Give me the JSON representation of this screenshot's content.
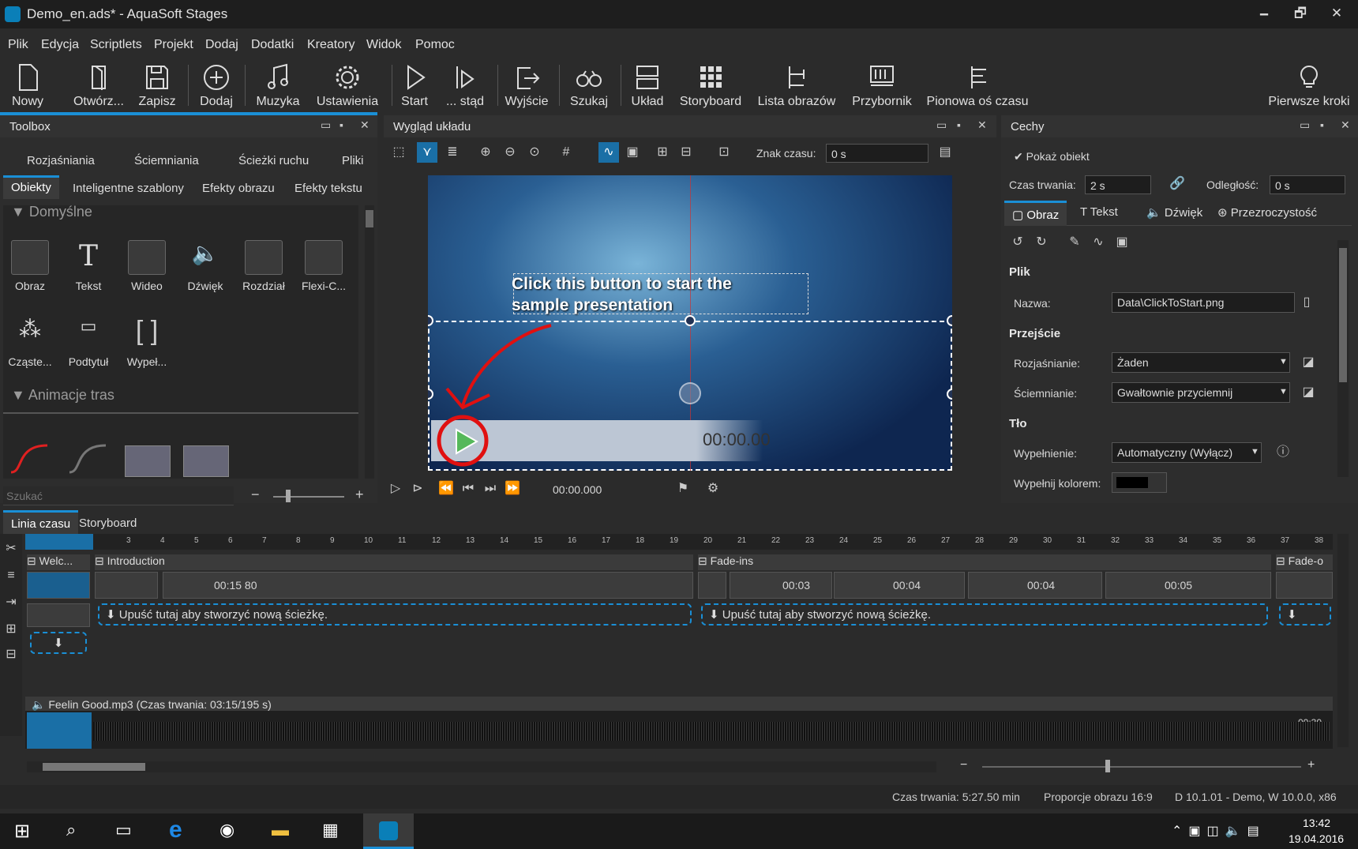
{
  "window": {
    "title": "Demo_en.ads* - AquaSoft Stages",
    "minimize": "🗕",
    "maximize": "🗗",
    "close": "✕"
  },
  "menu": [
    "Plik",
    "Edycja",
    "Scriptlets",
    "Projekt",
    "Dodaj",
    "Dodatki",
    "Kreatory",
    "Widok",
    "Pomoc"
  ],
  "toolbar": {
    "nowy": "Nowy",
    "otworz": "Otwórz...",
    "zapisz": "Zapisz",
    "dodaj": "Dodaj",
    "muzyka": "Muzyka",
    "ustawienia": "Ustawienia",
    "start": "Start",
    "stad": "... stąd",
    "wyjscie": "Wyjście",
    "szukaj": "Szukaj",
    "uklad": "Układ",
    "storyboard": "Storyboard",
    "lista": "Lista obrazów",
    "przybornik": "Przybornik",
    "pionowa": "Pionowa oś czasu",
    "pierwsze": "Pierwsze kroki"
  },
  "toolbox": {
    "title": "Toolbox",
    "tabs_row1": [
      "Rozjaśniania",
      "Ściemniania",
      "Ścieżki ruchu",
      "Pliki"
    ],
    "tabs_row2": [
      "Obiekty",
      "Inteligentne szablony",
      "Efekty obrazu",
      "Efekty tekstu"
    ],
    "section1": "Domyślne",
    "items": [
      "Obraz",
      "Tekst",
      "Wideo",
      "Dźwięk",
      "Rozdział",
      "Flexi-C...",
      "Cząste...",
      "Podtytuł",
      "Wypeł..."
    ],
    "section2": "Animacje tras",
    "search_placeholder": "Szukać"
  },
  "layout": {
    "title": "Wygląd układu",
    "znak_label": "Znak czasu:",
    "znak_value": "0 s",
    "slide_text_1": "Click this button to start the",
    "slide_text_2": "sample presentation",
    "player_time": "00:00.00",
    "playback_time": "00:00.000"
  },
  "properties": {
    "title": "Cechy",
    "show_object": "Pokaż obiekt",
    "czas_label": "Czas trwania:",
    "czas_value": "2 s",
    "odleglosc_label": "Odległość:",
    "odleglosc_value": "0 s",
    "tabs": [
      "Obraz",
      "Tekst",
      "Dźwięk",
      "Przezroczystość"
    ],
    "sec_plik": "Plik",
    "nazwa_label": "Nazwa:",
    "nazwa_value": "Data\\ClickToStart.png",
    "sec_przejscie": "Przejście",
    "rozj_label": "Rozjaśnianie:",
    "rozj_value": "Żaden",
    "sciem_label": "Ściemnianie:",
    "sciem_value": "Gwałtownie przyciemnij",
    "sec_tlo": "Tło",
    "wyp_label": "Wypełnienie:",
    "wyp_value": "Automatyczny (Wyłącz)",
    "wypkol_label": "Wypełnij kolorem:"
  },
  "timeline": {
    "tabs": [
      "Linia czasu",
      "Storyboard"
    ],
    "ruler": [
      "3",
      "4",
      "5",
      "6",
      "7",
      "8",
      "9",
      "10",
      "11",
      "12",
      "13",
      "14",
      "15",
      "16",
      "17",
      "18",
      "19",
      "20",
      "21",
      "22",
      "23",
      "24",
      "25",
      "26",
      "27",
      "28",
      "29",
      "30",
      "31",
      "32",
      "33",
      "34",
      "35",
      "36",
      "37",
      "38"
    ],
    "chapters": [
      "Welc...",
      "Introduction",
      "Fade-ins",
      "Fade-o"
    ],
    "clip_times": [
      "00:15 80",
      "00:03",
      "00:04",
      "00:04",
      "00:05"
    ],
    "drop_text": "Upuść tutaj aby stworzyć nową ścieżkę.",
    "audio": "Feelin Good.mp3 (Czas trwania: 03:15/195 s)",
    "audio_end": "-00:30"
  },
  "status": {
    "duration": "Czas trwania: 5:27.50 min",
    "ratio": "Proporcje obrazu 16:9",
    "version": "D 10.1.01 - Demo, W 10.0.0, x86"
  },
  "taskbar": {
    "time": "13:42",
    "date": "19.04.2016"
  },
  "colors": {
    "accent": "#1a8fd6",
    "bg": "#2b2b2b",
    "annotation": "#e01010"
  }
}
